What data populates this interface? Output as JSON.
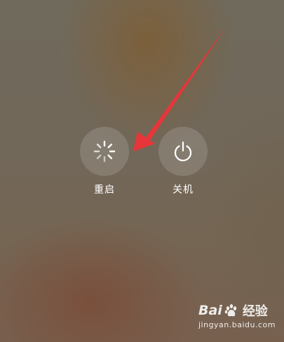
{
  "power_menu": {
    "restart": {
      "label": "重启",
      "icon": "restart-spinner-icon"
    },
    "shutdown": {
      "label": "关机",
      "icon": "power-icon"
    }
  },
  "annotation": {
    "arrow_color": "#e8353a"
  },
  "watermark": {
    "brand_prefix": "Bai",
    "brand_suffix": "经验",
    "url": "jingyan.baidu.com"
  }
}
